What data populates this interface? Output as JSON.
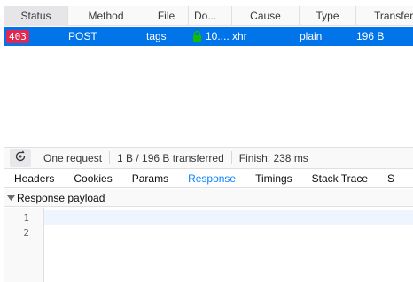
{
  "columns": {
    "status": "Status",
    "method": "Method",
    "file": "File",
    "domain": "Do...",
    "cause": "Cause",
    "type": "Type",
    "transferred": "Transferr"
  },
  "request": {
    "status": "403",
    "method": "POST",
    "file": "tags",
    "domain": "10....",
    "cause": "xhr",
    "type": "plain",
    "transferred": "196 B"
  },
  "summary": {
    "requests": "One request",
    "transferred": "1 B / 196 B transferred",
    "finish": "Finish: 238 ms"
  },
  "tabs": [
    "Headers",
    "Cookies",
    "Params",
    "Response",
    "Timings",
    "Stack Trace",
    "S"
  ],
  "payload": {
    "section_label": "Response payload",
    "line_numbers": [
      "1",
      "2"
    ]
  },
  "colors": {
    "selected_row": "#0074e8",
    "status_403": "#e22850",
    "accent": "#0a84ff",
    "lock": "#12bc00"
  }
}
